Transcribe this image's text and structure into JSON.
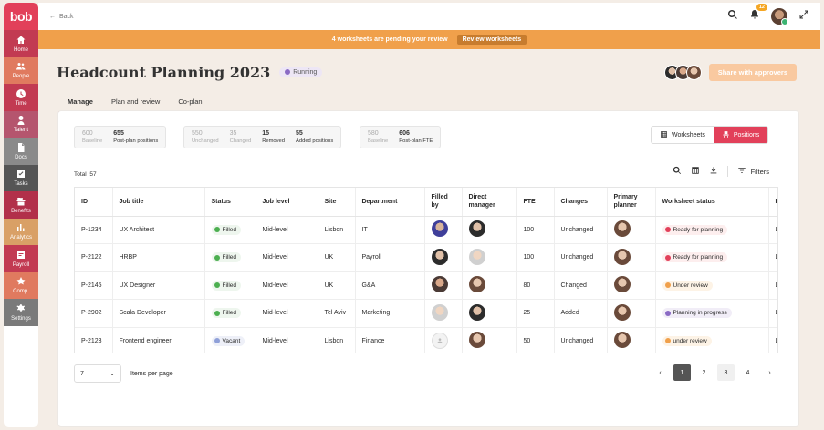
{
  "app": {
    "logo": "bob"
  },
  "sidebar": {
    "items": [
      {
        "label": "Home",
        "icon": "home-icon",
        "color": "#c23a52"
      },
      {
        "label": "People",
        "icon": "people-icon",
        "color": "#e07a5f"
      },
      {
        "label": "Time",
        "icon": "clock-icon",
        "color": "#c23a52"
      },
      {
        "label": "Talent",
        "icon": "talent-icon",
        "color": "#b5556e"
      },
      {
        "label": "Docs",
        "icon": "docs-icon",
        "color": "#8a8a8a"
      },
      {
        "label": "Tasks",
        "icon": "tasks-icon",
        "color": "#555555"
      },
      {
        "label": "Benefits",
        "icon": "benefits-icon",
        "color": "#b2304a"
      },
      {
        "label": "Analytics",
        "icon": "analytics-icon",
        "color": "#d9a066"
      },
      {
        "label": "Payroll",
        "icon": "payroll-icon",
        "color": "#c23a52"
      },
      {
        "label": "Comp.",
        "icon": "comp-icon",
        "color": "#e07a5f"
      },
      {
        "label": "Settings",
        "icon": "gear-icon",
        "color": "#7a7a7a"
      }
    ]
  },
  "topbar": {
    "back_label": "Back",
    "notification_count": "12"
  },
  "banner": {
    "message": "4 worksheets are pending your review",
    "button": "Review worksheets"
  },
  "header": {
    "title": "Headcount Planning 2023",
    "status": "Running",
    "share_button": "Share with approvers"
  },
  "tabs": [
    {
      "label": "Manage",
      "active": true
    },
    {
      "label": "Plan and review",
      "active": false
    },
    {
      "label": "Co-plan",
      "active": false
    }
  ],
  "stats": {
    "group1": [
      {
        "num": "600",
        "label": "Baseline",
        "muted": true
      },
      {
        "num": "655",
        "label": "Post-plan positions",
        "muted": false
      }
    ],
    "group2": [
      {
        "num": "550",
        "label": "Unchanged",
        "muted": true
      },
      {
        "num": "35",
        "label": "Changed",
        "muted": true
      },
      {
        "num": "15",
        "label": "Removed",
        "muted": false
      },
      {
        "num": "55",
        "label": "Added positions",
        "muted": false
      }
    ],
    "group3": [
      {
        "num": "580",
        "label": "Baseline",
        "muted": true
      },
      {
        "num": "606",
        "label": "Post-plan FTE",
        "muted": false
      }
    ]
  },
  "view_toggle": {
    "worksheets": "Worksheets",
    "positions": "Positions"
  },
  "total": "Total :57",
  "filters_label": "Filters",
  "table": {
    "columns": [
      "ID",
      "Job title",
      "Status",
      "Job level",
      "Site",
      "Department",
      "Filled by",
      "Direct manager",
      "FTE",
      "Changes",
      "Primary planner",
      "Worksheet status",
      "He"
    ],
    "rows": [
      {
        "id": "P-1234",
        "title": "UX Architect",
        "status": "Filled",
        "level": "Mid-level",
        "site": "Lisbon",
        "dept": "IT",
        "filled": "a1",
        "manager": "a2",
        "fte": "100",
        "changes": "Unchanged",
        "planner": "a3",
        "ws": "Ready for planning",
        "ws_type": "red",
        "extra": "La"
      },
      {
        "id": "P-2122",
        "title": "HRBP",
        "status": "Filled",
        "level": "Mid-level",
        "site": "UK",
        "dept": "Payroll",
        "filled": "a2",
        "manager": "a4",
        "fte": "100",
        "changes": "Unchanged",
        "planner": "a3",
        "ws": "Ready for planning",
        "ws_type": "red",
        "extra": "La"
      },
      {
        "id": "P-2145",
        "title": "UX Designer",
        "status": "Filled",
        "level": "Mid-level",
        "site": "UK",
        "dept": "G&A",
        "filled": "a5",
        "manager": "a3",
        "fte": "80",
        "changes": "Changed",
        "planner": "a3",
        "ws": "Under review",
        "ws_type": "orange",
        "extra": "La"
      },
      {
        "id": "P-2902",
        "title": "Scala Developer",
        "status": "Filled",
        "level": "Mid-level",
        "site": "Tel Aviv",
        "dept": "Marketing",
        "filled": "a4",
        "manager": "a2",
        "fte": "25",
        "changes": "Added",
        "planner": "a3",
        "ws": "Planning in progress",
        "ws_type": "purple",
        "extra": "La"
      },
      {
        "id": "P-2123",
        "title": "Frontend engineer",
        "status": "Vacant",
        "level": "Mid-level",
        "site": "Lisbon",
        "dept": "Finance",
        "filled": "empty",
        "manager": "a3",
        "fte": "50",
        "changes": "Unchanged",
        "planner": "a3",
        "ws": "under review",
        "ws_type": "orange",
        "extra": "La"
      }
    ]
  },
  "pagination": {
    "per_page_value": "7",
    "per_page_label": "Items per page",
    "pages": [
      "1",
      "2",
      "3",
      "4"
    ],
    "current": "1"
  },
  "colors": {
    "brand": "#e2405a",
    "banner": "#f0a04b",
    "filled": "#4caf50",
    "vacant": "#8fa0d8",
    "ready": "#e2405a",
    "review": "#f0a04b",
    "progress": "#8a6ac4"
  }
}
